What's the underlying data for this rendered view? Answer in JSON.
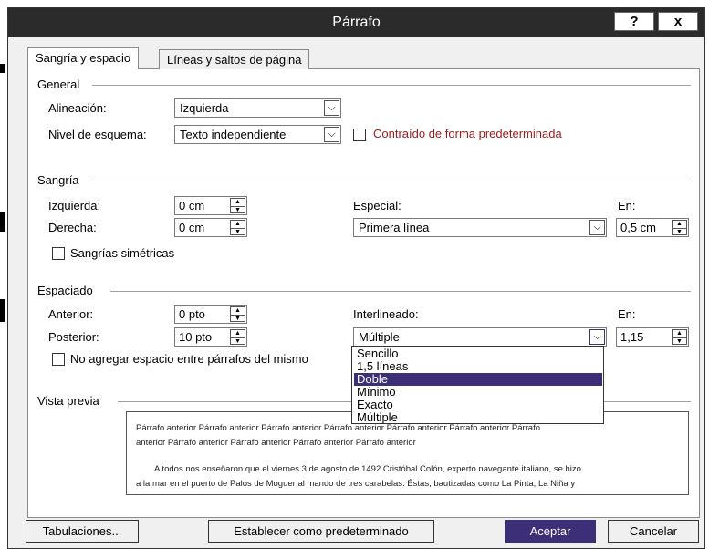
{
  "dialog": {
    "title": "Párrafo",
    "help_label": "?",
    "close_label": "x"
  },
  "tabs": [
    {
      "label": "Sangría y espacio"
    },
    {
      "label": "Líneas y saltos de página"
    }
  ],
  "general": {
    "heading": "General",
    "alignment_label": "Alineación:",
    "alignment_value": "Izquierda",
    "outline_label": "Nivel de esquema:",
    "outline_value": "Texto independiente",
    "collapsed_label": "Contraído de forma predeterminada"
  },
  "indent": {
    "heading": "Sangría",
    "left_label": "Izquierda:",
    "left_value": "0 cm",
    "right_label": "Derecha:",
    "right_value": "0 cm",
    "special_label": "Especial:",
    "special_value": "Primera línea",
    "by_label": "En:",
    "by_value": "0,5 cm",
    "mirror_label": "Sangrías simétricas"
  },
  "spacing": {
    "heading": "Espaciado",
    "before_label": "Anterior:",
    "before_value": "0 pto",
    "after_label": "Posterior:",
    "after_value": "10 pto",
    "line_spacing_label": "Interlineado:",
    "line_spacing_value": "Múltiple",
    "at_label": "En:",
    "at_value": "1,15",
    "no_space_label": "No agregar espacio entre párrafos del mismo",
    "options": [
      "Sencillo",
      "1,5 líneas",
      "Doble",
      "Mínimo",
      "Exacto",
      "Múltiple"
    ],
    "selected_option": "Doble"
  },
  "preview": {
    "heading": "Vista previa",
    "prev_line1": "Párrafo anterior Párrafo anterior Párrafo anterior Párrafo anterior Párrafo anterior Párrafo anterior Párrafo",
    "prev_line2": "anterior Párrafo anterior Párrafo anterior Párrafo anterior Párrafo anterior",
    "body_line1": "A todos nos enseñaron que el viernes 3 de agosto de 1492 Cristóbal Colón, experto navegante italiano, se hizo",
    "body_line2": "a la mar en el puerto de Palos de Moguer al mando de tres carabelas. Éstas, bautizadas como La Pinta, La Niña y"
  },
  "buttons": {
    "tabs": "Tabulaciones...",
    "default": "Establecer como predeterminado",
    "ok": "Aceptar",
    "cancel": "Cancelar"
  },
  "colors": {
    "titlebar": "#2b2b2b",
    "accent": "#3c2f78",
    "link_red": "#9b1c1c"
  }
}
